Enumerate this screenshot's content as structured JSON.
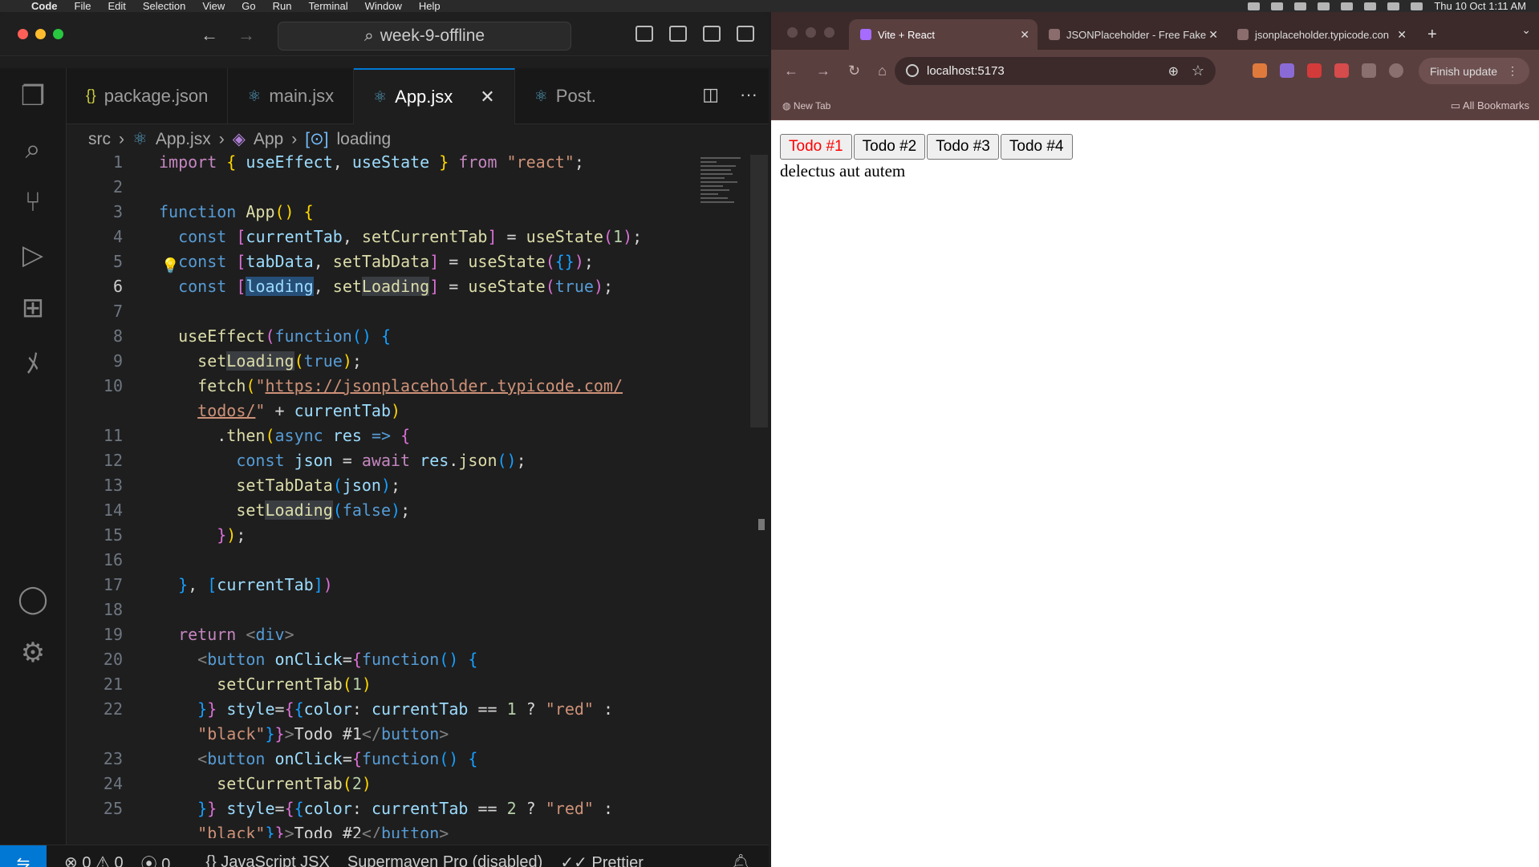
{
  "menubar": {
    "app": "Code",
    "items": [
      "File",
      "Edit",
      "Selection",
      "View",
      "Go",
      "Run",
      "Terminal",
      "Window",
      "Help"
    ],
    "clock": "Thu 10 Oct  1:11 AM"
  },
  "vscode": {
    "command_center": "week-9-offline",
    "tabs": [
      {
        "label": "package.json",
        "icon": "json-icon"
      },
      {
        "label": "main.jsx",
        "icon": "react-icon"
      },
      {
        "label": "App.jsx",
        "icon": "react-icon",
        "active": true
      },
      {
        "label": "Post.",
        "icon": "react-icon"
      }
    ],
    "breadcrumb": {
      "folder": "src",
      "file": "App.jsx",
      "component": "App",
      "symbol": "loading"
    },
    "status": {
      "errors": "0",
      "warnings": "0",
      "ports": "0",
      "language": "JavaScript JSX",
      "supermaven": "Supermaven Pro (disabled)",
      "prettier": "Prettier"
    }
  },
  "code": {
    "line_numbers": [
      "1",
      "2",
      "3",
      "4",
      "5",
      "6",
      "7",
      "8",
      "9",
      "10",
      "",
      "11",
      "12",
      "13",
      "14",
      "15",
      "16",
      "17",
      "18",
      "19",
      "20",
      "21",
      "22",
      "",
      "23",
      "24",
      "25",
      ""
    ],
    "current_line": "6"
  },
  "chrome": {
    "tabs": [
      {
        "label": "Vite + React",
        "active": true
      },
      {
        "label": "JSONPlaceholder - Free Fake",
        "active": false
      },
      {
        "label": "jsonplaceholder.typicode.con",
        "active": false
      }
    ],
    "url": "localhost:5173",
    "finish_update": "Finish update",
    "new_tab_bookmark": "New Tab",
    "all_bookmarks": "All Bookmarks"
  },
  "app_page": {
    "buttons": [
      {
        "label": "Todo #1",
        "color": "#ff0000"
      },
      {
        "label": "Todo #2",
        "color": "#000000"
      },
      {
        "label": "Todo #3",
        "color": "#000000"
      },
      {
        "label": "Todo #4",
        "color": "#000000"
      }
    ],
    "todo_title": "delectus aut autem"
  },
  "colors": {
    "accent": "#0078d4",
    "chrome_frame": "#5a3f3f"
  }
}
